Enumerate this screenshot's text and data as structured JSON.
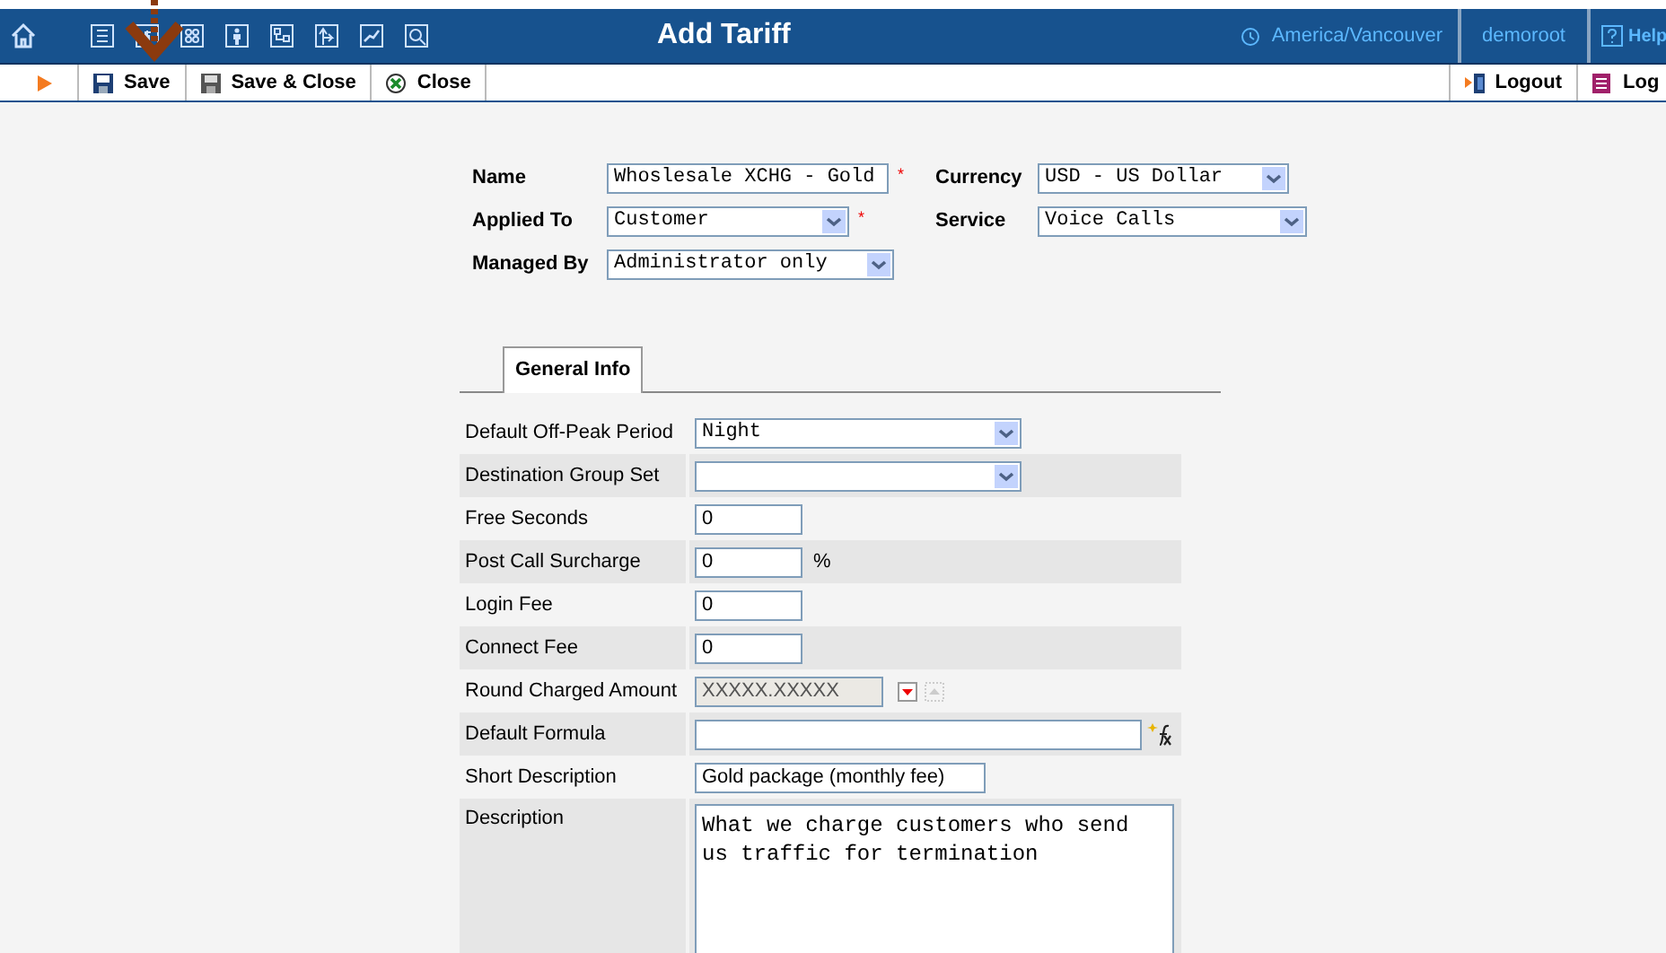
{
  "header": {
    "title": "Add Tariff",
    "timezone": "America/Vancouver",
    "user": "demoroot",
    "help": "Help"
  },
  "toolbar": {
    "buttons": [
      {
        "label": "Save",
        "kind": "save"
      },
      {
        "label": "Save & Close",
        "kind": "save_close"
      },
      {
        "label": "Close",
        "kind": "close"
      }
    ],
    "right_buttons": [
      {
        "label": "Logout",
        "kind": "logout"
      },
      {
        "label": "Log",
        "kind": "log"
      }
    ]
  },
  "top_rows": [
    [
      {
        "label": "Name",
        "kind": "input",
        "value": "Whoslesale XCHG - Gold",
        "marker": "*"
      },
      {
        "label": "Currency",
        "kind": "select",
        "value": "USD - US Dollar"
      }
    ],
    [
      {
        "label": "Applied To",
        "kind": "select",
        "value": "Customer",
        "marker": "*"
      },
      {
        "label": "Service",
        "kind": "select",
        "value": "Voice Calls"
      }
    ],
    [
      {
        "label": "Managed By",
        "kind": "select",
        "value": "Administrator only"
      }
    ]
  ],
  "tabs": [
    {
      "label": "General Info",
      "selected": true
    }
  ],
  "rows": [
    {
      "label": "Default Off-Peak Period",
      "kind": "select",
      "value": "Night"
    },
    {
      "label": "Destination Group Set",
      "kind": "select"
    },
    {
      "label": "Free Seconds",
      "kind": "input",
      "value": "0"
    },
    {
      "label": "Post Call Surcharge",
      "kind": "input",
      "value": "0",
      "suffix": "%"
    },
    {
      "label": "Login Fee",
      "kind": "input",
      "value": "0"
    },
    {
      "label": "Connect Fee",
      "kind": "input",
      "value": "0"
    },
    {
      "label": "Round Charged Amount",
      "kind": "readonly",
      "value": "XXXXX.XXXXX"
    },
    {
      "label": "Default Formula",
      "kind": "formula"
    },
    {
      "label": "Short Description",
      "kind": "text",
      "value": "Gold package (monthly fee)"
    },
    {
      "label": "Description",
      "kind": "textarea",
      "value": "What we charge customers who send us traffic for termination"
    }
  ]
}
